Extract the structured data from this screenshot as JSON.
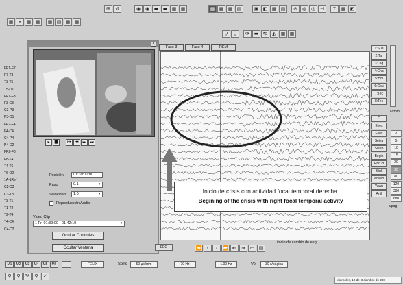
{
  "toolbar_top": {
    "g1": [
      "⊞",
      "↺"
    ],
    "g2": [
      "◉",
      "◉",
      "▬",
      "▬",
      "▦",
      "▦"
    ],
    "g3": [
      "▦",
      "▦",
      "▦",
      "▤"
    ],
    "g4": [
      "▣",
      "◧",
      "▦",
      "▤",
      "⊘",
      "◍",
      "◎",
      "⊣",
      "⌶",
      "▦",
      "◩"
    ]
  },
  "toolbar_left": [
    "▦",
    "✕",
    "▦",
    "▦",
    "▦",
    "▤",
    "▦",
    "▦"
  ],
  "toolbar_second": [
    "⚲",
    "⚲",
    "⟳",
    "▬",
    "↹",
    "◭",
    "▦",
    "▦"
  ],
  "tabs": [
    "Fase 3",
    "Fase 4",
    "REM"
  ],
  "channels": [
    "FP1-F7",
    "F7-T3",
    "T3-T5",
    "T5-O1",
    "FP1-F3",
    "F3-C3",
    "C3-P3",
    "P3-O1",
    "FP2-F4",
    "F4-C4",
    "C4-P4",
    "P4-O2",
    "FP2-F8",
    "F8-T4",
    "T4-T6",
    "T6-O2",
    "1A-1Ref",
    "C2-C3",
    "C3-T3",
    "T3-T1",
    "T1-T2",
    "T2-T4",
    "T4-C4",
    "C4-C2"
  ],
  "right_events": [
    "1:Sue",
    "2:Tar",
    "3:Leg",
    "4:Cha",
    "5:Hol",
    "6:Cou",
    "7:Tec",
    "8:Tec"
  ],
  "right_events2": [
    "C",
    "Eyes",
    "Eyes",
    "Seizu",
    "Sleep",
    "Begin",
    "End H",
    "Blink",
    "Movem",
    "Yawn",
    "Artif"
  ],
  "scale_label": "µV/mm",
  "scale_values": [
    "2",
    "5",
    "10",
    "15",
    "20",
    "30",
    "80",
    "120",
    "380",
    "680"
  ],
  "unit_label": "s/pag",
  "video": {
    "posicion_label": "Posición",
    "posicion_value": "01:39:00:00",
    "paso_label": "Paso",
    "paso_value": "0.1",
    "velocidad_label": "Velocidad",
    "velocidad_value": "1.0",
    "audio_label": "Reproducción Audio",
    "clip_label": "Video Clip",
    "clip_value": "1 Fri 01:39:00 - 01:42:10",
    "hide_controls": "Ocultar Controles",
    "hide_window": "Ocultar Ventana",
    "playback_icons": [
      "▸",
      "■",
      "⏮",
      "⏮",
      "⏭",
      "⏭"
    ]
  },
  "overlay_note": "inicio de cambio de eeg",
  "callout": {
    "spanish": "Inicio de crisis con actividad focal temporal derecha.",
    "english": "Begining of the crisis with right focal temporal activity"
  },
  "nav_icons": [
    "⏪",
    "‹",
    "›",
    "⏩",
    "⇤",
    "⇥",
    "▭",
    "▤"
  ],
  "eeg_tab": "EEG",
  "status_bar": {
    "montages": [
      "M1",
      "M2",
      "M3",
      "M4",
      "M5",
      "M6"
    ],
    "patient": "FELIX",
    "sens_label": "Sens",
    "sens_value": "50 µV/mm",
    "hf_value": "70 Hz",
    "lf_value": "1.00 Hz",
    "vel_label": "Vel",
    "vel_value": "30 s/página"
  },
  "bottom_icons": [
    "⚲",
    "⚲",
    "%",
    "⚲",
    "✓"
  ],
  "date_text": "Miércoles, 12 de Diciembre de 200"
}
